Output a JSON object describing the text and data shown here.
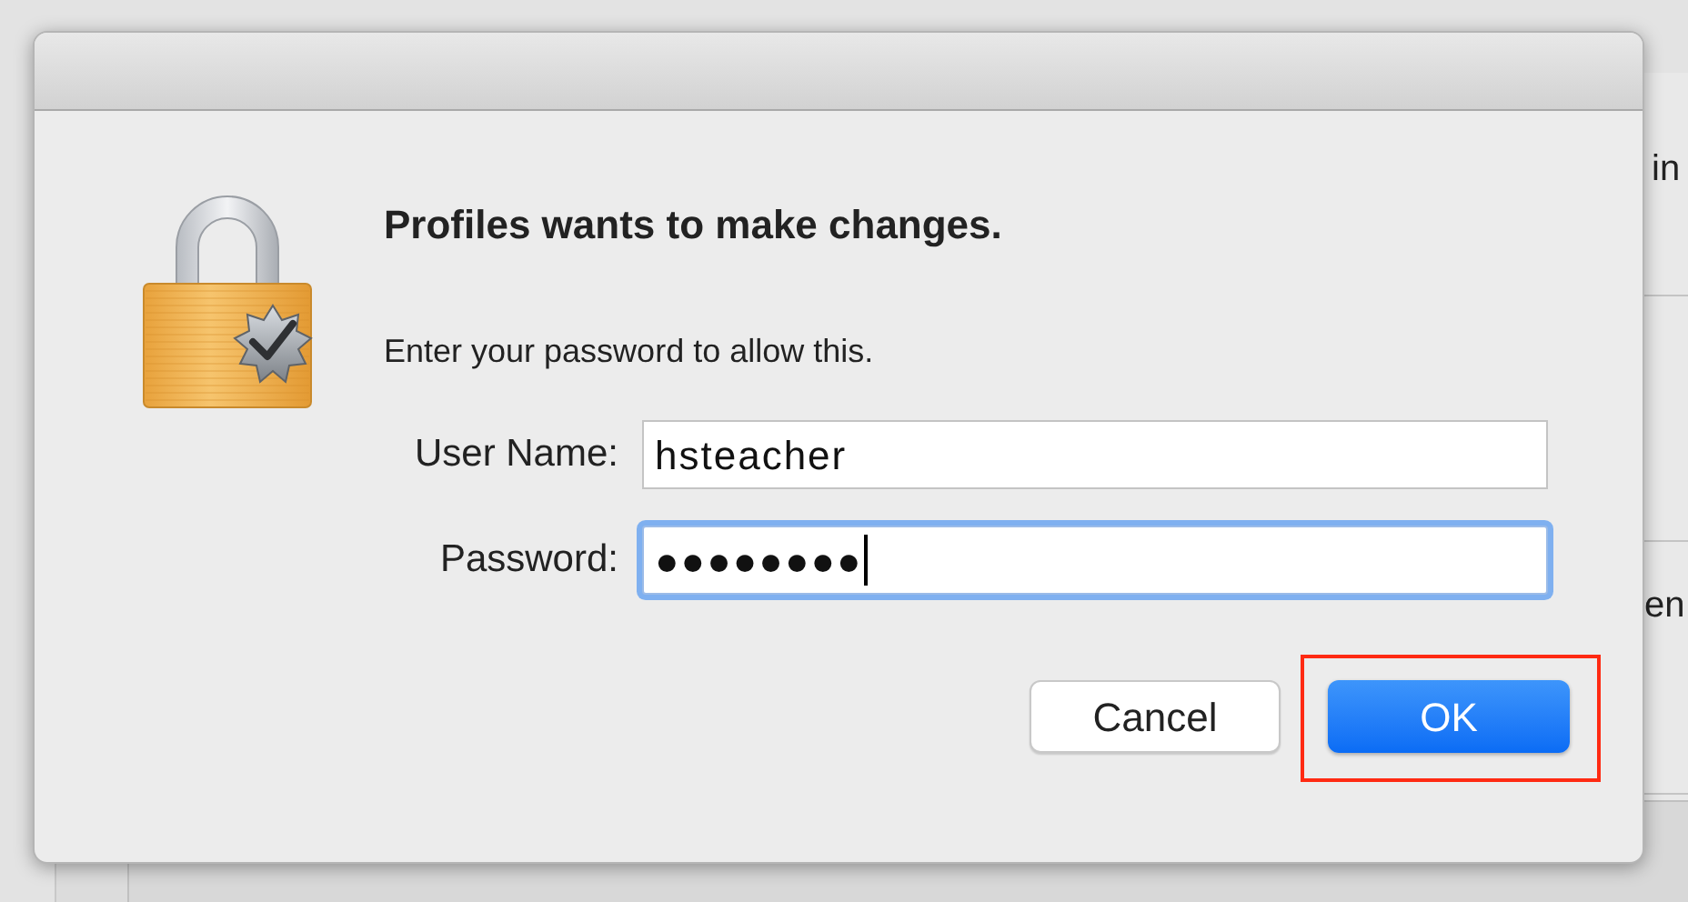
{
  "background": {
    "texts": [
      "in",
      "en"
    ]
  },
  "dialog": {
    "title": "Profiles wants to make changes.",
    "message": "Enter your password to allow this.",
    "fields": [
      {
        "label": "User Name:",
        "value": "hsteacher",
        "focused": false
      },
      {
        "label": "Password:",
        "value": "●●●●●●●●",
        "focused": true
      }
    ],
    "buttons": [
      {
        "label": "Cancel",
        "default": false,
        "highlighted": false
      },
      {
        "label": "OK",
        "default": true,
        "highlighted": true
      }
    ]
  }
}
